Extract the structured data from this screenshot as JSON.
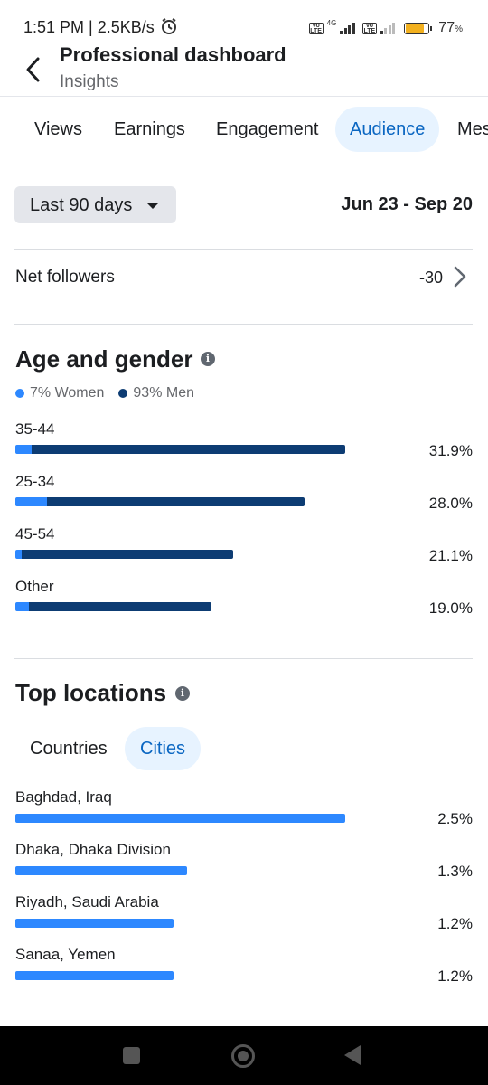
{
  "status_bar": {
    "time": "1:51 PM | 2.5KB/s",
    "network_label": "4G",
    "volte_label": "Vo LTE",
    "battery_percent": "77",
    "battery_unit": "%"
  },
  "header": {
    "title": "Professional dashboard",
    "subtitle": "Insights"
  },
  "tabs": [
    {
      "label": "Views"
    },
    {
      "label": "Earnings"
    },
    {
      "label": "Engagement"
    },
    {
      "label": "Audience"
    },
    {
      "label": "Mes"
    }
  ],
  "filter": {
    "range_label": "Last 90 days",
    "date_range": "Jun 23 - Sep 20"
  },
  "net_followers": {
    "label": "Net followers",
    "value": "-30"
  },
  "age_gender": {
    "title": "Age and gender",
    "legend": {
      "women": "7% Women",
      "men": "93% Men"
    },
    "colors": {
      "women": "#2d88ff",
      "men": "#0d3c73"
    },
    "rows": [
      {
        "label": "35-44",
        "value": "31.9%",
        "share": 31.9,
        "women_fraction": 0.05
      },
      {
        "label": "25-34",
        "value": "28.0%",
        "share": 28.0,
        "women_fraction": 0.11
      },
      {
        "label": "45-54",
        "value": "21.1%",
        "share": 21.1,
        "women_fraction": 0.03
      },
      {
        "label": "Other",
        "value": "19.0%",
        "share": 19.0,
        "women_fraction": 0.07
      }
    ]
  },
  "top_locations": {
    "title": "Top locations",
    "tabs": [
      {
        "label": "Countries"
      },
      {
        "label": "Cities"
      }
    ],
    "rows": [
      {
        "label": "Baghdad, Iraq",
        "value": "2.5%",
        "share": 2.5
      },
      {
        "label": "Dhaka, Dhaka Division",
        "value": "1.3%",
        "share": 1.3
      },
      {
        "label": "Riyadh, Saudi Arabia",
        "value": "1.2%",
        "share": 1.2
      },
      {
        "label": "Sanaa, Yemen",
        "value": "1.2%",
        "share": 1.2
      }
    ]
  }
}
